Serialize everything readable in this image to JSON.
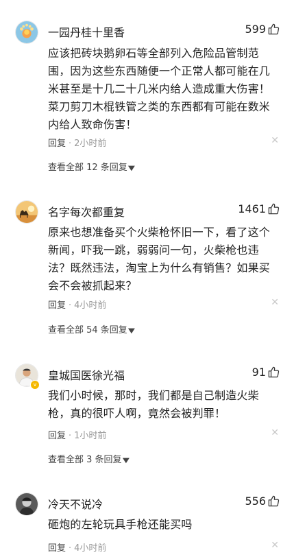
{
  "comments": [
    {
      "username": "一园丹桂十里香",
      "likes": "599",
      "text": "应该把砖块鹅卵石等全部列入危险品管制范围，因为这些东西随便一个正常人都可能在几米甚至是十几二十几米内给人造成重大伤害！菜刀剪刀木棍铁管之类的东西都有可能在数米内给人致命伤害！",
      "reply_label": "回复",
      "time": "2小时前",
      "view_all": "查看全部 12 条回复",
      "avatar_icon": "flower-avatar-icon"
    },
    {
      "username": "名字每次都重复",
      "likes": "1461",
      "text": "原来也想准备买个火柴枪怀旧一下，看了这个新闻，吓我一跳，弱弱问一句，火柴枪也违法？既然违法，淘宝上为什么有销售？如果买会不会被抓起来？",
      "reply_label": "回复",
      "time": "4小时前",
      "view_all": "查看全部 54 条回复",
      "avatar_icon": "camel-sunset-avatar-icon"
    },
    {
      "username": "皇城国医徐光福",
      "likes": "91",
      "text": "我们小时候，那时，我们都是自己制造火柴枪，真的很吓人啊，竟然会被判罪！",
      "reply_label": "回复",
      "time": "1小时前",
      "view_all": "查看全部 3 条回复",
      "avatar_icon": "person-avatar-icon"
    },
    {
      "username": "冷天不说冷",
      "likes": "556",
      "text": "砸炮的左轮玩具手枪还能买吗",
      "reply_label": "回复",
      "time": "4小时前",
      "avatar_icon": "dark-portrait-avatar-icon"
    }
  ],
  "colors": {
    "text": "#222222",
    "meta": "#999999",
    "verified_badge": "#f5b800"
  }
}
